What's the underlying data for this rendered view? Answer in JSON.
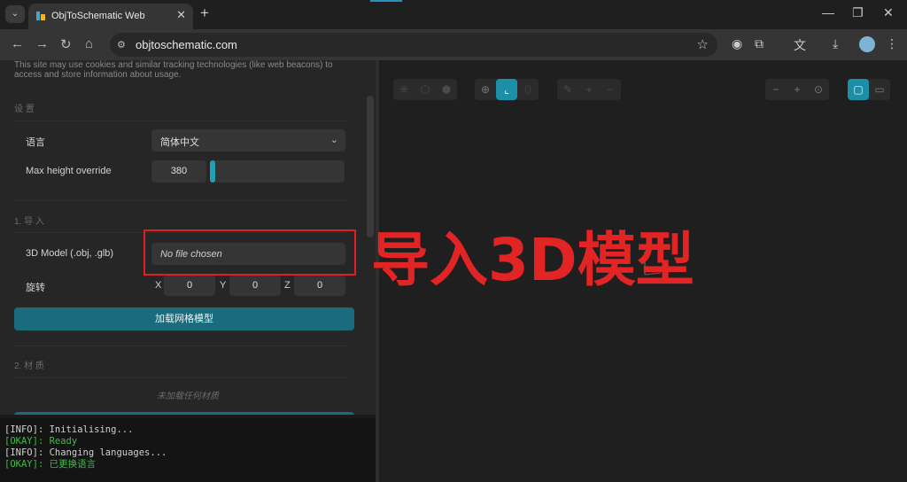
{
  "browser": {
    "tab_title": "ObjToSchematic Web",
    "url": "objtoschematic.com"
  },
  "left_panel": {
    "cookie_notice": "This site may use cookies and similar tracking technologies (like web beacons) to access and store information about usage.",
    "settings": {
      "section_title": "设 置",
      "language_label": "语言",
      "language_value": "简体中文",
      "height_label": "Max height override",
      "height_value": "380",
      "height_slider_fraction": 0.0
    },
    "import": {
      "section_title": "1. 导 入",
      "model_label": "3D Model (.obj, .glb)",
      "file_value": "No file chosen",
      "rotation_label": "旋转",
      "rotation": {
        "x_label": "X",
        "x": "0",
        "y_label": "Y",
        "y": "0",
        "z_label": "Z",
        "z": "0"
      },
      "load_button": "加载网格模型"
    },
    "materials": {
      "section_title": "2. 材 质",
      "empty_text": "未加载任何材质"
    }
  },
  "console": [
    {
      "tag": "[INFO]",
      "type": "info",
      "text": ": Initialising..."
    },
    {
      "tag": "[OKAY]",
      "type": "ok",
      "text": ": Ready"
    },
    {
      "tag": "[INFO]",
      "type": "info",
      "text": ": Changing languages..."
    },
    {
      "tag": "[OKAY]",
      "type": "ok",
      "text": ": 已更换语言"
    }
  ],
  "annotation": {
    "label": "导入3D模型",
    "color": "#e32424"
  },
  "colors": {
    "accent": "#1c8fa8",
    "button": "#1a6b7b"
  }
}
